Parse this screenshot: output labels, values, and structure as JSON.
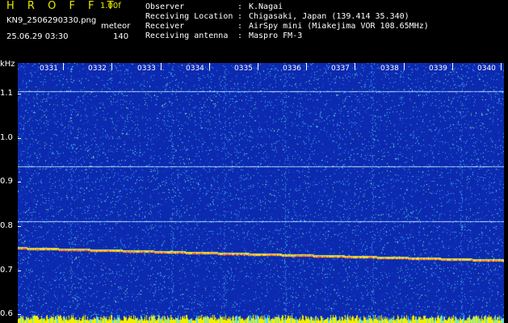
{
  "header": {
    "brand": "H R O F F T",
    "version": "1.00f",
    "filename": "KN9_2506290330.png",
    "mode": "meteor",
    "datetime": "25.06.29 03:30",
    "count": "140"
  },
  "info": [
    {
      "key": "Observer",
      "value": "K.Nagai"
    },
    {
      "key": "Receiving Location",
      "value": "Chigasaki, Japan (139.414 35.340)"
    },
    {
      "key": "Receiver",
      "value": "AirSpy mini (Miakejima VOR 108.65MHz)"
    },
    {
      "key": "Receiving antenna",
      "value": "Maspro FM-3"
    }
  ],
  "chart_data": {
    "type": "heatmap",
    "ylabel": "kHz",
    "y_ticks": [
      "1.1",
      "1.0",
      "0.9",
      "0.8",
      "0.7",
      "0.6"
    ],
    "ylim": [
      0.58,
      1.17
    ],
    "x_ticks": [
      "0331",
      "0332",
      "0333",
      "0334",
      "0335",
      "0336",
      "0337",
      "0338",
      "0339",
      "0340"
    ],
    "horizontal_lines_khz": [
      1.105,
      0.935,
      0.81
    ],
    "carrier_trace": {
      "start_khz": 0.75,
      "end_khz": 0.722
    },
    "colors": {
      "background": "#0c2ab0",
      "noise_hi": "#3aa0ff",
      "trace": "#ffd020",
      "hline": "#c8e8ff"
    }
  },
  "axis": {
    "unit": "kHz"
  }
}
